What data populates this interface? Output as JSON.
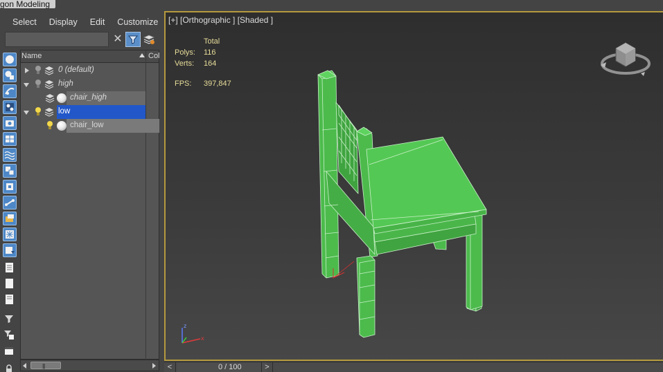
{
  "app": {
    "title_fragment": "gon Modeling"
  },
  "menu": [
    "Select",
    "Display",
    "Edit",
    "Customize"
  ],
  "search": {
    "value": "",
    "placeholder": ""
  },
  "scene_tree": {
    "columns": {
      "name": "Name",
      "second": "Colo"
    },
    "rows": [
      {
        "label": "0 (default)",
        "italic": true
      },
      {
        "label": "high",
        "italic": true
      },
      {
        "label": "chair_high",
        "italic": true
      },
      {
        "label": "low",
        "italic": false
      },
      {
        "label": "chair_low",
        "italic": false
      }
    ]
  },
  "viewport": {
    "label": "[+] [Orthographic ] [Shaded ]",
    "stats": {
      "header": "Total",
      "polys_label": "Polys:",
      "polys_value": "116",
      "verts_label": "Verts:",
      "verts_value": "164",
      "fps_label": "FPS:",
      "fps_value": "397,847"
    },
    "model_color": "#4fbf4f",
    "frame_color": "#b59a3e"
  },
  "timeline": {
    "left_arrow": "<",
    "right_arrow": ">",
    "frame_text": "0 / 100"
  }
}
